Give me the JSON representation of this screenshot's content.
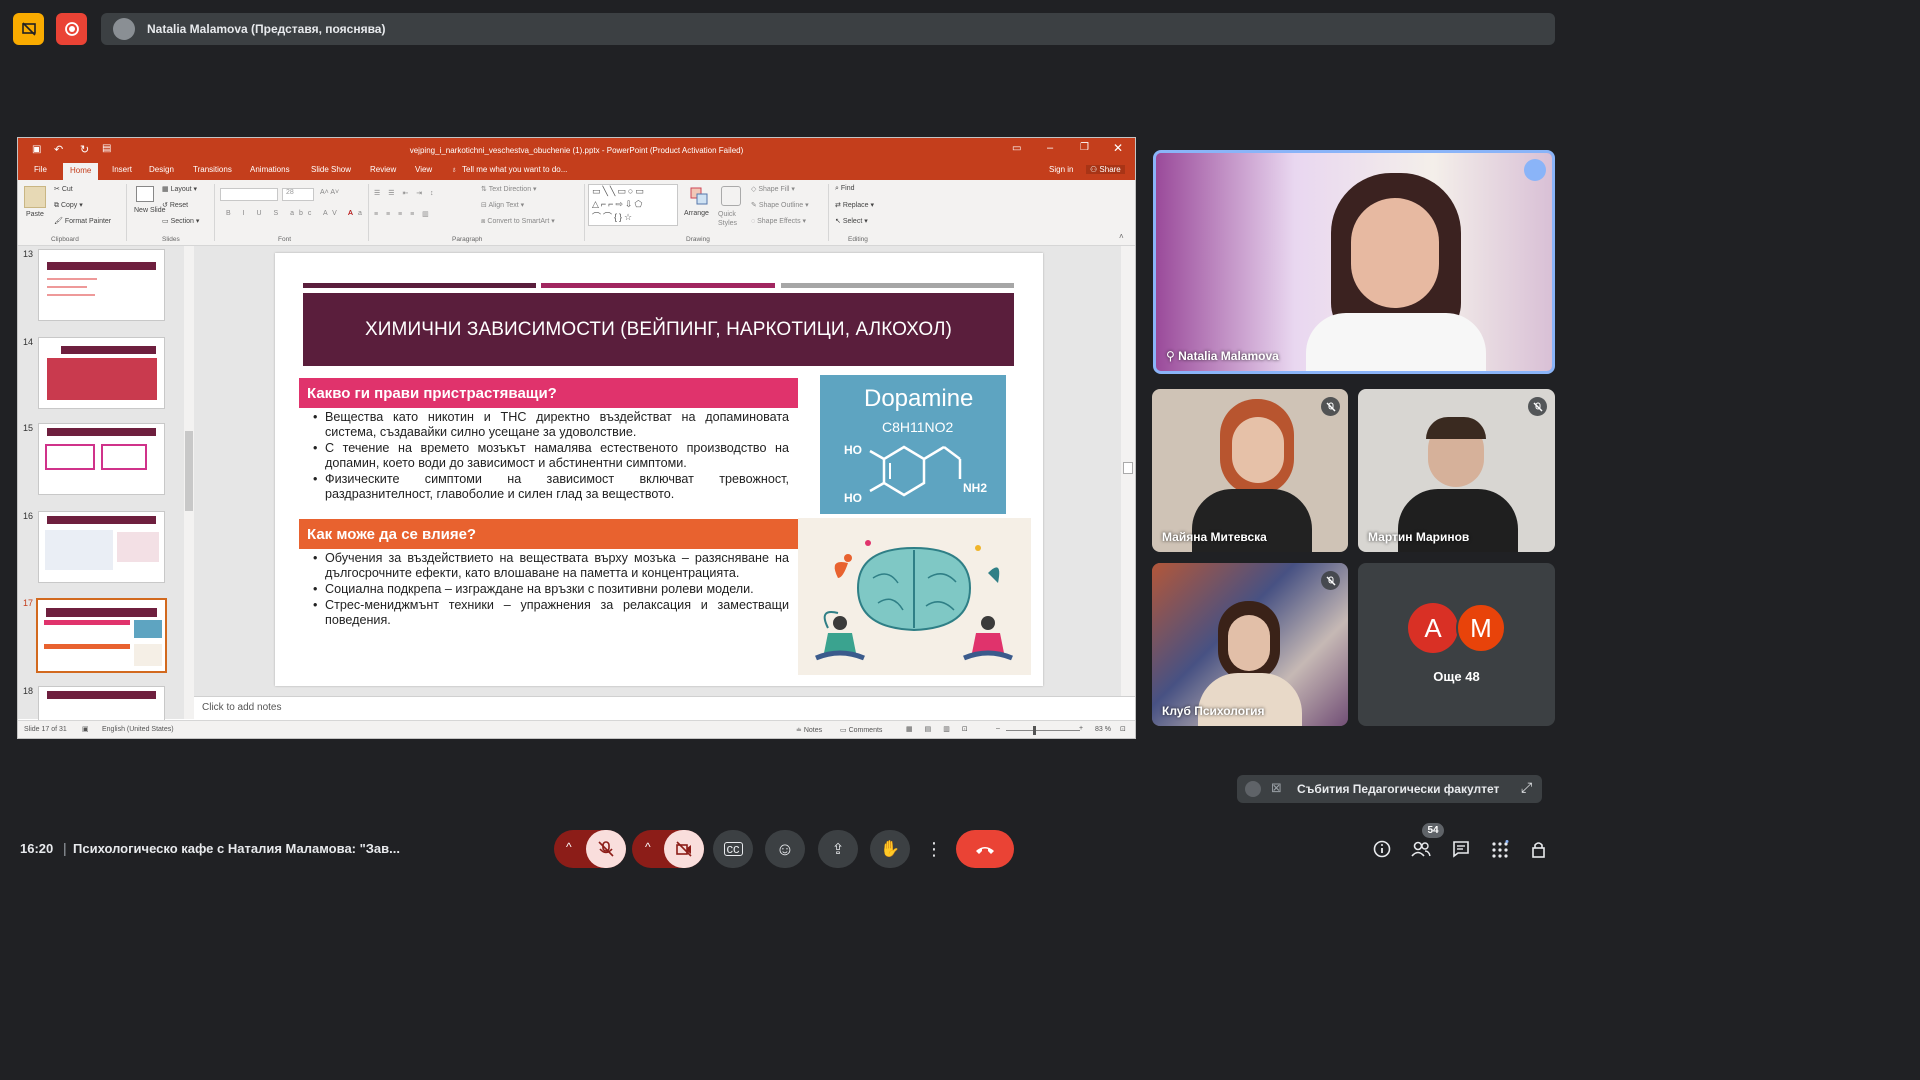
{
  "top_bar": {
    "presenter_text": "Natalia Malamova (Представя, пояснява)"
  },
  "powerpoint": {
    "title_bar": "vejping_i_narkotichni_veschestva_obuchenie (1).pptx - PowerPoint (Product Activation Failed)",
    "tabs": [
      "File",
      "Home",
      "Insert",
      "Design",
      "Transitions",
      "Animations",
      "Slide Show",
      "Review",
      "View"
    ],
    "tell_me": "Tell me what you want to do...",
    "sign_in": "Sign in",
    "share": "Share",
    "ribbon": {
      "cut": "Cut",
      "copy": "Copy",
      "format_painter": "Format Painter",
      "paste": "Paste",
      "clipboard": "Clipboard",
      "new_slide": "New Slide",
      "layout": "Layout",
      "reset": "Reset",
      "section": "Section",
      "slides": "Slides",
      "font_size": "28",
      "font": "Font",
      "text_direction": "Text Direction",
      "align_text": "Align Text",
      "convert_smartart": "Convert to SmartArt",
      "paragraph": "Paragraph",
      "arrange": "Arrange",
      "quick_styles": "Quick Styles",
      "shape_fill": "Shape Fill",
      "shape_outline": "Shape Outline",
      "shape_effects": "Shape Effects",
      "drawing": "Drawing",
      "find": "Find",
      "replace": "Replace",
      "select": "Select",
      "editing": "Editing"
    },
    "thumbnails": [
      {
        "num": "13"
      },
      {
        "num": "14"
      },
      {
        "num": "15"
      },
      {
        "num": "16"
      },
      {
        "num": "17"
      },
      {
        "num": "18"
      }
    ],
    "notes_placeholder": "Click to add notes",
    "status": {
      "slide_count": "Slide 17 of 31",
      "language": "English (United States)",
      "notes": "Notes",
      "comments": "Comments",
      "zoom": "83 %"
    }
  },
  "slide": {
    "title": "ХИМИЧНИ ЗАВИСИМОСТИ (ВЕЙПИНГ, НАРКОТИЦИ, АЛКОХОЛ)",
    "section1": {
      "heading": "Какво ги прави пристрастяващи?",
      "bullets": [
        "Вещества като никотин и THC директно въздействат на допаминовата система, създавайки силно усещане за удоволствие.",
        "С течение на времето мозъкът намалява естественото производство на допамин, което води до зависимост и абстинентни симптоми.",
        "Физическите симптоми на зависимост включват тревожност, раздразнителност, главоболие и силен глад за веществото."
      ]
    },
    "section2": {
      "heading": "Как може да се влияе?",
      "bullets": [
        "Обучения за въздействието на веществата върху мозъка – разясняване на дългосрочните ефекти, като влошаване на паметта и концентрацията.",
        "Социална подкрепа – изграждане на връзки с позитивни ролеви модели.",
        "Стрес-мениджмънт техники – упражнения за релаксация и заместващи поведения."
      ]
    },
    "dopamine": {
      "name": "Dopamine",
      "formula": "C8H11NO2",
      "ho1": "HO",
      "ho2": "HO",
      "nh2": "NH2"
    },
    "colors": {
      "title_bg": "#5a1e3c",
      "heading1": "#e0336c",
      "heading2": "#e8622f",
      "dopamine_bg": "#5ea4c1"
    }
  },
  "participants": [
    {
      "name": "Natalia Malamova"
    },
    {
      "name": "Майяна Митевска"
    },
    {
      "name": "Мартин Маринов"
    },
    {
      "name": "Клуб Психология"
    }
  ],
  "more_tile": {
    "letters": [
      "A",
      "M"
    ],
    "label": "Още 48"
  },
  "event_pill": {
    "text": "Събития Педагогически факултет"
  },
  "bottom_bar": {
    "time": "16:20",
    "separator": "|",
    "meeting_title": "Психологическо кафе с Наталия Маламова: \"Зав...",
    "participant_count": "54"
  }
}
